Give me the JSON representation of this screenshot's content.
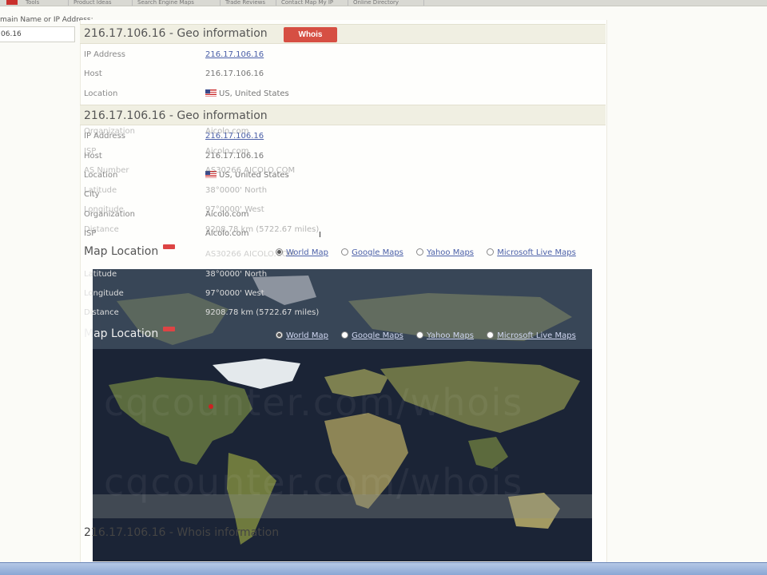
{
  "browser": {
    "tabs": [
      "Tools",
      "Product Ideas",
      "Search Engine Maps",
      "Trade Reviews",
      "Contact Map My IP",
      "Online Directory"
    ]
  },
  "search": {
    "label": "main Name or IP Address:",
    "value": "06.16"
  },
  "geo_primary": {
    "title": "216.17.106.16 - Geo information",
    "whois_button": "Whois",
    "rows": [
      {
        "label": "IP Address",
        "value": "216.17.106.16"
      },
      {
        "label": "Host",
        "value": "216.17.106.16"
      },
      {
        "label": "Location",
        "value": "US, United States"
      }
    ]
  },
  "geo_secondary": {
    "title": "216.17.106.16 - Geo information",
    "rows": [
      {
        "label": "IP Address",
        "value": "216.17.106.16"
      },
      {
        "label": "Host",
        "value": "216.17.106.16"
      },
      {
        "label": "Location",
        "value": "US, United States"
      },
      {
        "label": "City",
        "value": "38°0000' North"
      },
      {
        "label": "Organization",
        "value": "Aicolo.com"
      },
      {
        "label": "ISP",
        "value": "Aicolo.com"
      }
    ]
  },
  "ghost_rows": {
    "rows": [
      {
        "label": "Organization",
        "value": "Aicolo.com"
      },
      {
        "label": "ISP",
        "value": "Aicolo.com"
      },
      {
        "label": "AS Number",
        "value": "AS30266 AICOLO.COM"
      },
      {
        "label": "Latitude",
        "value": "38°0000' North"
      },
      {
        "label": "Longitude",
        "value": "97°0000' West"
      },
      {
        "label": "Distance",
        "value": "9208.78 km (5722.67 miles)"
      }
    ]
  },
  "detail_rows": [
    {
      "label": "AS Number",
      "value": "AS30266 AICOLO.COM"
    },
    {
      "label": "Latitude",
      "value": "38°0000' North"
    },
    {
      "label": "Longitude",
      "value": "97°0000' West"
    },
    {
      "label": "Distance",
      "value": "9208.78 km (5722.67 miles)"
    }
  ],
  "map_location": {
    "title": "Map Location",
    "options": [
      "World Map",
      "Google Maps",
      "Yahoo Maps",
      "Microsoft Live Maps"
    ],
    "selected": "World Map"
  },
  "map": {
    "watermark": "cqcounter.com/whois"
  },
  "whois_info": {
    "title": "216.17.106.16 - Whois information"
  }
}
